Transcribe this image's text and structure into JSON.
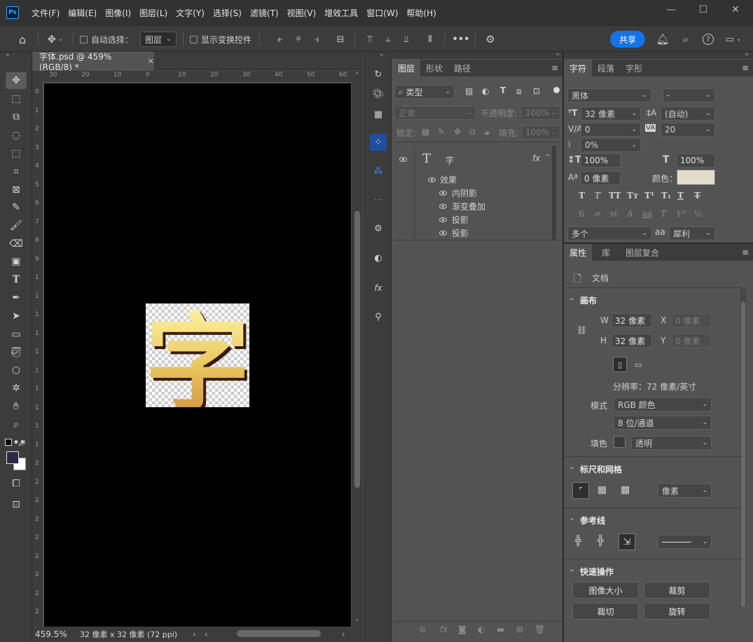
{
  "menubar": {
    "logo": "Ps",
    "items": [
      "文件(F)",
      "编辑(E)",
      "图像(I)",
      "图层(L)",
      "文字(Y)",
      "选择(S)",
      "滤镜(T)",
      "视图(V)",
      "增效工具",
      "窗口(W)",
      "帮助(H)"
    ]
  },
  "options": {
    "auto_select_label": "自动选择：",
    "auto_select_target": "图层",
    "show_transform_label": "显示变换控件",
    "share_label": "共享"
  },
  "document": {
    "tab_title": "字体.psd @ 459%(RGB/8) *",
    "ruler_top": [
      "30",
      "20",
      "10",
      "0",
      "10",
      "20",
      "30",
      "40",
      "50",
      "60"
    ],
    "ruler_left": [
      "0",
      "1",
      "2",
      "3",
      "4",
      "5",
      "6",
      "7",
      "8",
      "9",
      "1",
      "1",
      "1",
      "1",
      "1",
      "1",
      "1",
      "1",
      "1",
      "1",
      "2",
      "2",
      "2",
      "2",
      "2",
      "2",
      "2",
      "2",
      "2"
    ],
    "artwork_char": "字",
    "zoom": "459.5%",
    "doc_info": "32 像素 x 32 像素 (72 ppi)"
  },
  "layers": {
    "tabs": [
      "图层",
      "形状",
      "路径"
    ],
    "filter_type": "类型",
    "blend_mode": "正常",
    "opacity_label": "不透明度:",
    "opacity_value": "100%",
    "lock_label": "锁定:",
    "fill_label": "填充:",
    "fill_value": "100%",
    "layer_name": "字",
    "effects_label": "效果",
    "effects": [
      "内阴影",
      "渐变叠加",
      "投影",
      "投影"
    ]
  },
  "character": {
    "tabs": [
      "字符",
      "段落",
      "字形"
    ],
    "font_family": "黑体",
    "font_style": "-",
    "font_size": "32 像素",
    "leading": "(自动)",
    "kerning": "0",
    "tracking": "20",
    "scale_vertical_pct": "0%",
    "vertical_scale": "100%",
    "horizontal_scale": "100%",
    "baseline_shift": "0 像素",
    "color_label": "颜色：",
    "color_value": "#e4dccb",
    "language": "多个",
    "aa_icon": "aa",
    "antialias": "犀利"
  },
  "properties": {
    "tabs": [
      "属性",
      "库",
      "图层复合"
    ],
    "doc_label": "文档",
    "canvas_title": "画布",
    "w_label": "W",
    "w_value": "32 像素",
    "h_label": "H",
    "h_value": "32 像素",
    "x_label": "X",
    "x_placeholder": "0 像素",
    "y_label": "Y",
    "y_placeholder": "0 像素",
    "resolution": "分辨率：72 像素/英寸",
    "mode_label": "模式",
    "mode_value": "RGB 颜色",
    "depth_value": "8 位/通道",
    "fill_label": "填色",
    "fill_value": "透明",
    "rulers_title": "标尺和网格",
    "units": "像素",
    "guides_title": "参考线",
    "quick_title": "快速操作",
    "quick_buttons": [
      "图像大小",
      "裁剪",
      "裁切",
      "旋转"
    ]
  }
}
